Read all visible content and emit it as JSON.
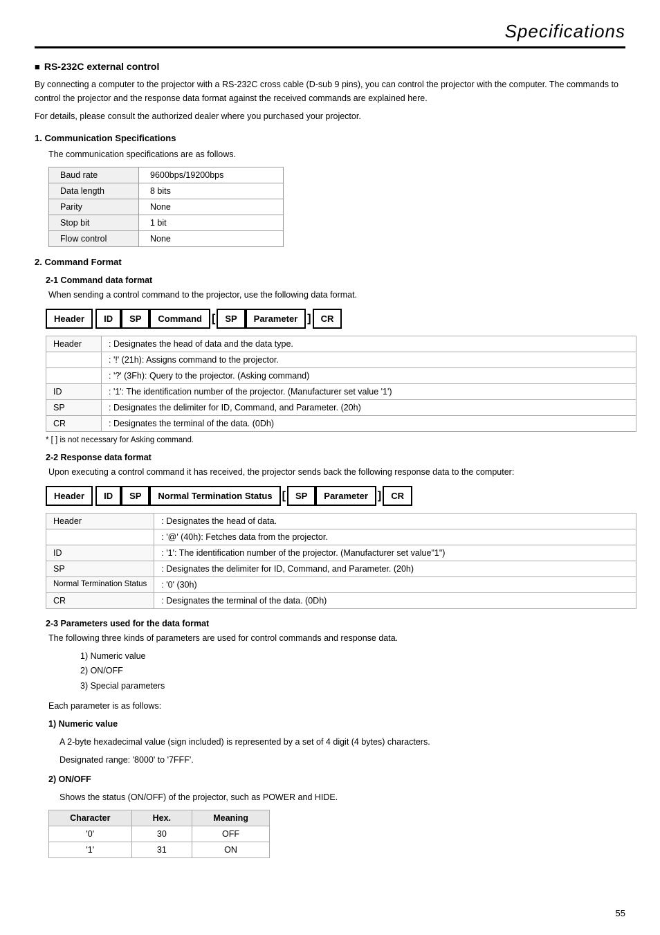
{
  "page": {
    "title": "Specifications",
    "page_number": "55"
  },
  "rs232c": {
    "heading": "RS-232C external control",
    "intro_lines": [
      "By connecting a computer to the projector with a RS-232C cross cable (D-sub 9 pins), you can control the projector with the computer. The commands to control the projector and the response data format against the received commands are explained here.",
      "For details, please consult the authorized dealer where you purchased your projector."
    ]
  },
  "comm_specs": {
    "heading": "1.  Communication Specifications",
    "intro": "The communication specifications are as follows.",
    "rows": [
      {
        "label": "Baud rate",
        "value": "9600bps/19200bps"
      },
      {
        "label": "Data length",
        "value": "8 bits"
      },
      {
        "label": "Parity",
        "value": "None"
      },
      {
        "label": "Stop bit",
        "value": "1 bit"
      },
      {
        "label": "Flow control",
        "value": "None"
      }
    ]
  },
  "cmd_format": {
    "heading": "2.  Command Format",
    "cmd_data": {
      "heading": "2-1 Command data format",
      "intro": "When sending a control command to the projector, use the following data format.",
      "diagram_parts": [
        "Header",
        "ID",
        "SP",
        "Command",
        "[",
        "SP",
        "Parameter",
        "]",
        "CR"
      ],
      "table_rows": [
        {
          "label": "Header",
          "value": ": Designates the head of data and the data type."
        },
        {
          "label": "",
          "value": ": '!' (21h): Assigns command to the projector."
        },
        {
          "label": "",
          "value": ": '?' (3Fh): Query to the projector. (Asking command)"
        },
        {
          "label": "ID",
          "value": ": '1': The identification number of the projector. (Manufacturer set value '1')"
        },
        {
          "label": "SP",
          "value": ": Designates the delimiter for ID, Command, and Parameter. (20h)"
        },
        {
          "label": "CR",
          "value": ": Designates the terminal of the data. (0Dh)"
        }
      ],
      "footnote": "* [ ] is not necessary for Asking command."
    },
    "response_data": {
      "heading": "2-2 Response data format",
      "intro": "Upon executing a control command it has received, the projector sends back the following response data to the computer:",
      "diagram_parts": [
        "Header",
        "ID",
        "SP",
        "Normal Termination Status",
        "[",
        "SP",
        "Parameter",
        "]",
        "CR"
      ],
      "table_rows": [
        {
          "label": "Header",
          "value": ": Designates the head of data."
        },
        {
          "label": "",
          "value": ": '@' (40h): Fetches data from the projector."
        },
        {
          "label": "ID",
          "value": ": '1': The identification number of the projector. (Manufacturer set value\"1\")"
        },
        {
          "label": "SP",
          "value": ": Designates the delimiter for ID, Command, and Parameter. (20h)"
        },
        {
          "label": "Normal Termination Status",
          "value": ": '0' (30h)"
        },
        {
          "label": "CR",
          "value": ": Designates the terminal of the data. (0Dh)"
        }
      ]
    },
    "parameters": {
      "heading": "2-3 Parameters used for the data format",
      "intro": "The following three kinds of parameters are used for control commands and response data.",
      "list": [
        "1)  Numeric value",
        "2)  ON/OFF",
        "3)  Special parameters"
      ],
      "each_label": "Each parameter is as follows:",
      "numeric_heading": "1) Numeric value",
      "numeric_text": "A 2-byte hexadecimal value (sign included) is represented by a set of 4 digit (4 bytes) characters.",
      "numeric_range": "Designated range: '8000' to '7FFF'.",
      "onoff_heading": "2) ON/OFF",
      "onoff_text": "Shows the status (ON/OFF) of the projector, such as POWER and HIDE.",
      "onoff_table": {
        "headers": [
          "Character",
          "Hex.",
          "Meaning"
        ],
        "rows": [
          {
            "char": "'0'",
            "hex": "30",
            "meaning": "OFF"
          },
          {
            "char": "'1'",
            "hex": "31",
            "meaning": "ON"
          }
        ]
      }
    }
  }
}
